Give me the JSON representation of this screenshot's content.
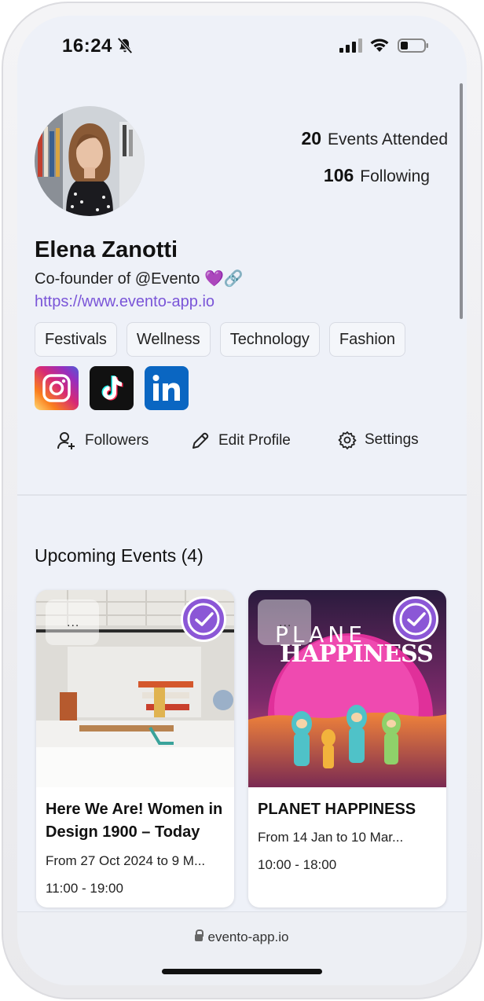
{
  "status_bar": {
    "time": "16:24"
  },
  "profile": {
    "name": "Elena Zanotti",
    "bio": "Co-founder of @Evento 💜🔗",
    "link": "https://www.evento-app.io",
    "stats": [
      {
        "value": "20",
        "label": "Events Attended"
      },
      {
        "value": "106",
        "label": "Following"
      }
    ],
    "tags": [
      "Festivals",
      "Wellness",
      "Technology",
      "Fashion"
    ],
    "socials": [
      "instagram-icon",
      "tiktok-icon",
      "linkedin-icon"
    ]
  },
  "actions": {
    "followers": "Followers",
    "edit_profile": "Edit Profile",
    "settings": "Settings"
  },
  "events_section": {
    "title": "Upcoming Events (4)",
    "events": [
      {
        "title": "Here We Are! Women in Design 1900 – Today",
        "dates": "From 27 Oct 2024 to 9 M...",
        "hours": "11:00 - 19:00"
      },
      {
        "title": "PLANET HAPPINESS",
        "poster_text_top": "PLANE",
        "poster_text_bottom": "HAPPINESS",
        "dates": "From 14 Jan to 10 Mar...",
        "hours": "10:00 - 18:00"
      }
    ]
  },
  "browser": {
    "url": "evento-app.io"
  },
  "colors": {
    "accent": "#8b57d6",
    "link": "#7a55d8",
    "background": "#eef1f8"
  }
}
